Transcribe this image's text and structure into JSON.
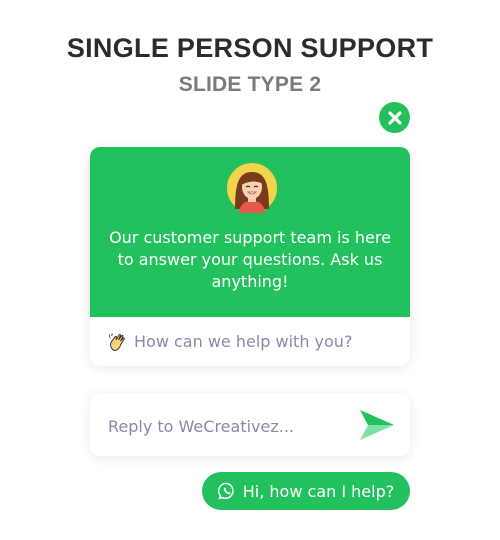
{
  "header": {
    "title": "SINGLE PERSON SUPPORT",
    "subtitle": "SLIDE TYPE 2"
  },
  "close_button": {
    "icon": "close-icon"
  },
  "support_card": {
    "avatar_icon": "female-agent-avatar",
    "message": "Our customer support team is here to answer your questions. Ask us anything!",
    "prompt_icon": "waving-hand-icon",
    "prompt": "How can we help with you?"
  },
  "reply": {
    "placeholder": "Reply to WeCreativez...",
    "send_icon": "send-icon"
  },
  "launcher": {
    "icon": "whatsapp-icon",
    "label": "Hi, how can I help?"
  },
  "colors": {
    "accent": "#22c15e",
    "title": "#2c2c2c",
    "subtitle": "#7a7a7a",
    "muted_text": "#8a8aa8"
  }
}
